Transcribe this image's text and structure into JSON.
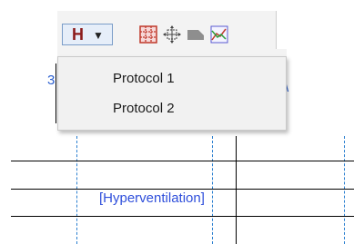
{
  "toolbar": {
    "h_button_label": "H",
    "icons": [
      "grid-icon",
      "move-handle-icon",
      "tag-shape-icon",
      "graph-icon"
    ]
  },
  "dropdown_menu": {
    "items": [
      {
        "label": "Protocol 1"
      },
      {
        "label": "Protocol 2"
      }
    ]
  },
  "grid": {
    "annotation": "[Hyperventilation]"
  },
  "background_glyphs": {
    "left": "3",
    "right": "\\"
  }
}
